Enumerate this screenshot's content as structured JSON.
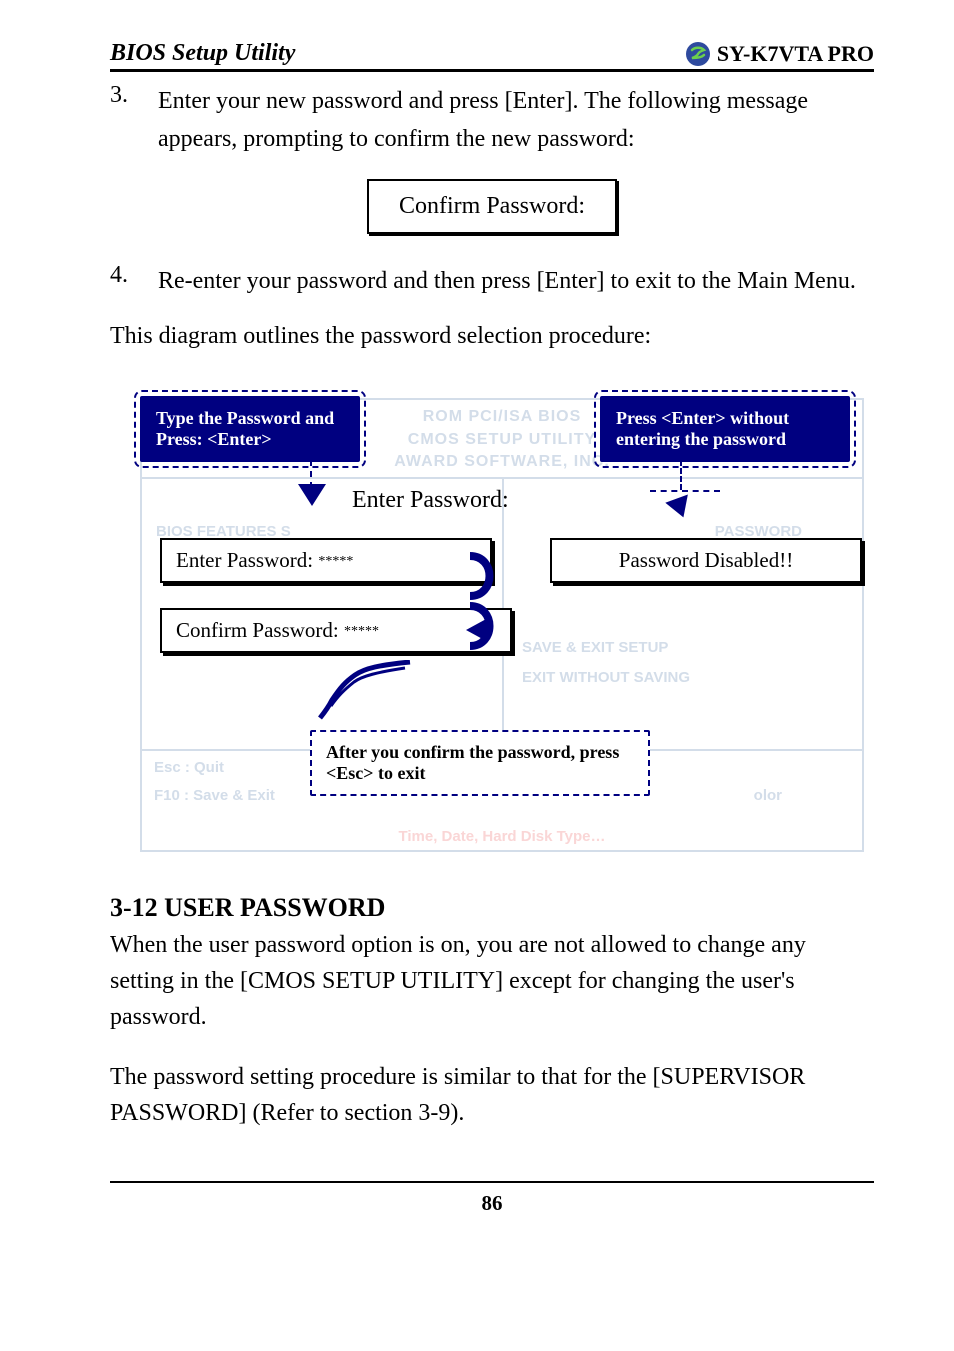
{
  "header": {
    "left": "BIOS Setup Utility",
    "right": "SY-K7VTA PRO"
  },
  "step3": {
    "num": "3.",
    "text": "Enter your new password and press [Enter]. The following message appears, prompting to confirm the new password:"
  },
  "confirm_box": "Confirm Password:",
  "step4": {
    "num": "4.",
    "text": "Re-enter your password and then press [Enter] to exit to the Main Menu."
  },
  "outline_para": "This diagram outlines the password selection procedure:",
  "diagram": {
    "bg": {
      "t1": "ROM PCI/ISA BIOS",
      "t2": "CMOS SETUP UTILITY",
      "t3": "AWARD SOFTWARE, INC.",
      "enter_password": "Enter Password:",
      "bios_features": "BIOS FEATURES S",
      "password_label": "PASSWORD",
      "save_exit": "SAVE & EXIT SETUP",
      "exit_without": "EXIT WITHOUT SAVING",
      "esc": "Esc   : Quit",
      "f10": "F10  : Save & Exit",
      "color": "olor",
      "bottom": "Time, Date, Hard Disk Type…"
    },
    "callouts": {
      "type_pwd": "Type the Password and Press: <Enter>",
      "press_enter_without": "Press <Enter> without entering the password",
      "after_confirm": "After you confirm the password, press <Esc> to exit"
    },
    "inputs": {
      "enter_label": "Enter Password: ",
      "enter_stars": "*****",
      "confirm_label": "Confirm Password: ",
      "confirm_stars": "*****",
      "disabled": "Password Disabled!!"
    }
  },
  "section": {
    "heading": "3-12  USER PASSWORD",
    "p1": "When the user password option is on, you are not allowed to change any setting in the [CMOS SETUP UTILITY] except for changing the user's password.",
    "p2": "The password setting procedure is similar to that for the [SUPERVISOR PASSWORD] (Refer to section 3-9)."
  },
  "page_number": "86"
}
